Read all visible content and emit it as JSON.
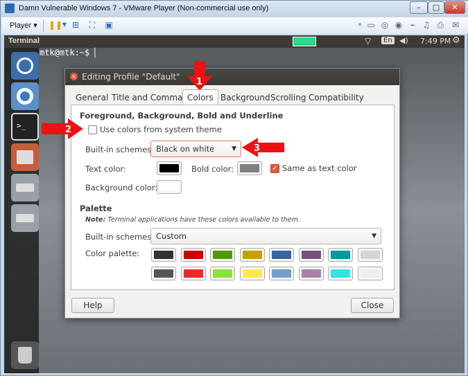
{
  "window": {
    "title": "Damn Vulnerable Windows 7 - VMware Player (Non-commercial use only)",
    "minimize": "–",
    "maximize": "□",
    "close": "✕"
  },
  "toolbar": {
    "player_label": "Player ▾"
  },
  "ubuntu": {
    "topbar_title": "Terminal",
    "keyboard": "En",
    "time": "7:49 PM",
    "prompt": "mtk@mtk:~$ ▏"
  },
  "dialog": {
    "title": "Editing Profile \"Default\"",
    "close_glyph": "×",
    "tabs": [
      "General",
      "Title and Command",
      "Colors",
      "Background",
      "Scrolling",
      "Compatibility"
    ],
    "section_heading": "Foreground, Background, Bold and Underline",
    "use_system_colors": "Use colors from system theme",
    "builtin_schemes_label": "Built-in schemes:",
    "builtin_schemes_value": "Black on white",
    "text_color_label": "Text color:",
    "bold_color_label": "Bold color:",
    "same_as_text_label": "Same as text color",
    "background_color_label": "Background color:",
    "palette_heading": "Palette",
    "note_bold": "Note:",
    "note_text": " Terminal applications have these colors available to them.",
    "palette_schemes_label": "Built-in schemes:",
    "palette_schemes_value": "Custom",
    "color_palette_label": "Color palette:",
    "help_button": "Help",
    "close_button": "Close"
  },
  "colors": {
    "text_color": "#000000",
    "bold_color": "#7f7f7f",
    "background_color": "#ffffff",
    "palette_row1": [
      "#2e3436",
      "#cc0000",
      "#4e9a06",
      "#c4a000",
      "#3465a4",
      "#75507b",
      "#06989a",
      "#d3d7cf"
    ],
    "palette_row2": [
      "#555753",
      "#ef2929",
      "#8ae234",
      "#fce94f",
      "#729fcf",
      "#ad7fa8",
      "#34e2e2",
      "#eeeeec"
    ]
  },
  "annotations": {
    "step1": "1",
    "step2": "2",
    "step3": "3"
  }
}
